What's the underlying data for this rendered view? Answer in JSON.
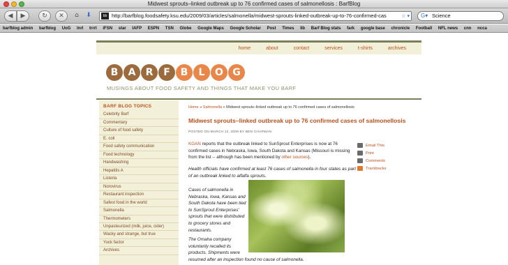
{
  "browser": {
    "window_title": "Midwest sprouts–linked outbreak up to 76 confirmed cases of salmonellosis : BarfBlog",
    "url": "http://barfblog.foodsafety.ksu.edu/2009/03/articles/salmonella/midwest-sprouts-linked-outbreak-up-to-76-confirmed-cas",
    "search_value": "Science",
    "favicon_text": "bb",
    "bookmarks": [
      "barfblog admin",
      "barfblog",
      "UoG",
      "lnrl",
      "trrrl",
      "iFSN",
      "star",
      "IAFP",
      "ESPN",
      "TSN",
      "Globe",
      "Google Maps",
      "Google Scholar",
      "Post",
      "Times",
      "lib",
      "Barf Blog stats",
      "fark",
      "google base",
      "chronicle",
      "Football",
      "NFL news",
      "cnn",
      "ncca"
    ]
  },
  "site": {
    "nav": [
      "home",
      "about",
      "contact",
      "services",
      "t-shirts",
      "archives"
    ],
    "logo_letters": [
      "B",
      "A",
      "R",
      "F",
      "B",
      "L",
      "O",
      "G"
    ],
    "tagline": "MUSINGS ABOUT FOOD SAFETY AND THINGS THAT MAKE YOU BARF",
    "sidebar": {
      "heading": "BARF BLOG TOPICS",
      "items": [
        "Celebrity Barf",
        "Commentary",
        "Culture of food safety",
        "E. coli",
        "Food safety communication",
        "Food technology",
        "Handwashing",
        "Hepatitis A",
        "Listeria",
        "Norovirus",
        "Restaurant inspection",
        "Safest food in the world",
        "Salmonella",
        "Thermometers",
        "Unpasteurized (milk, juice, cider)",
        "Wacky and strange, but true",
        "Yuck factor",
        "Archives"
      ]
    },
    "post": {
      "breadcrumb_home": "Home",
      "breadcrumb_sep": "»",
      "breadcrumb_cat": "Salmonella",
      "breadcrumb_current": "Midwest sprouts–linked outbreak up to 76 confirmed cases of salmonellosis",
      "title": "Midwest sprouts–linked outbreak up to 76 confirmed cases of salmonellosis",
      "posted": "POSTED ON MARCH 12, 2009 BY BEN CHAPMAN",
      "source_link": "KGAN",
      "body_a": " reports that the outbreak linked to SunSprout Enterprises is now at 76 confirmed cases in Nebraska, Iowa, South Dakota and Kansas (Missouri is missing from the list -- although has been mentioned by ",
      "body_link": "other sources",
      "body_b": ").",
      "italic_1": "Health officials have confirmed at least 76 cases of salmonella in four states as part of an outbreak linked to alfalfa sprouts.",
      "italic_2": "Cases of salmonella in Nebraska, Iowa, Kansas and South Dakota have been tied to SunSprout Enterprises' sprouts that were distributed to grocery stores and restaurants.",
      "italic_3a": "The Omaha company voluntarily recalled its products. Shipments were",
      "italic_3b": "resumed after an inspection found no cause of salmonella.",
      "tools": [
        "Email This",
        "Print",
        "Comments",
        "Trackbacks"
      ]
    }
  }
}
